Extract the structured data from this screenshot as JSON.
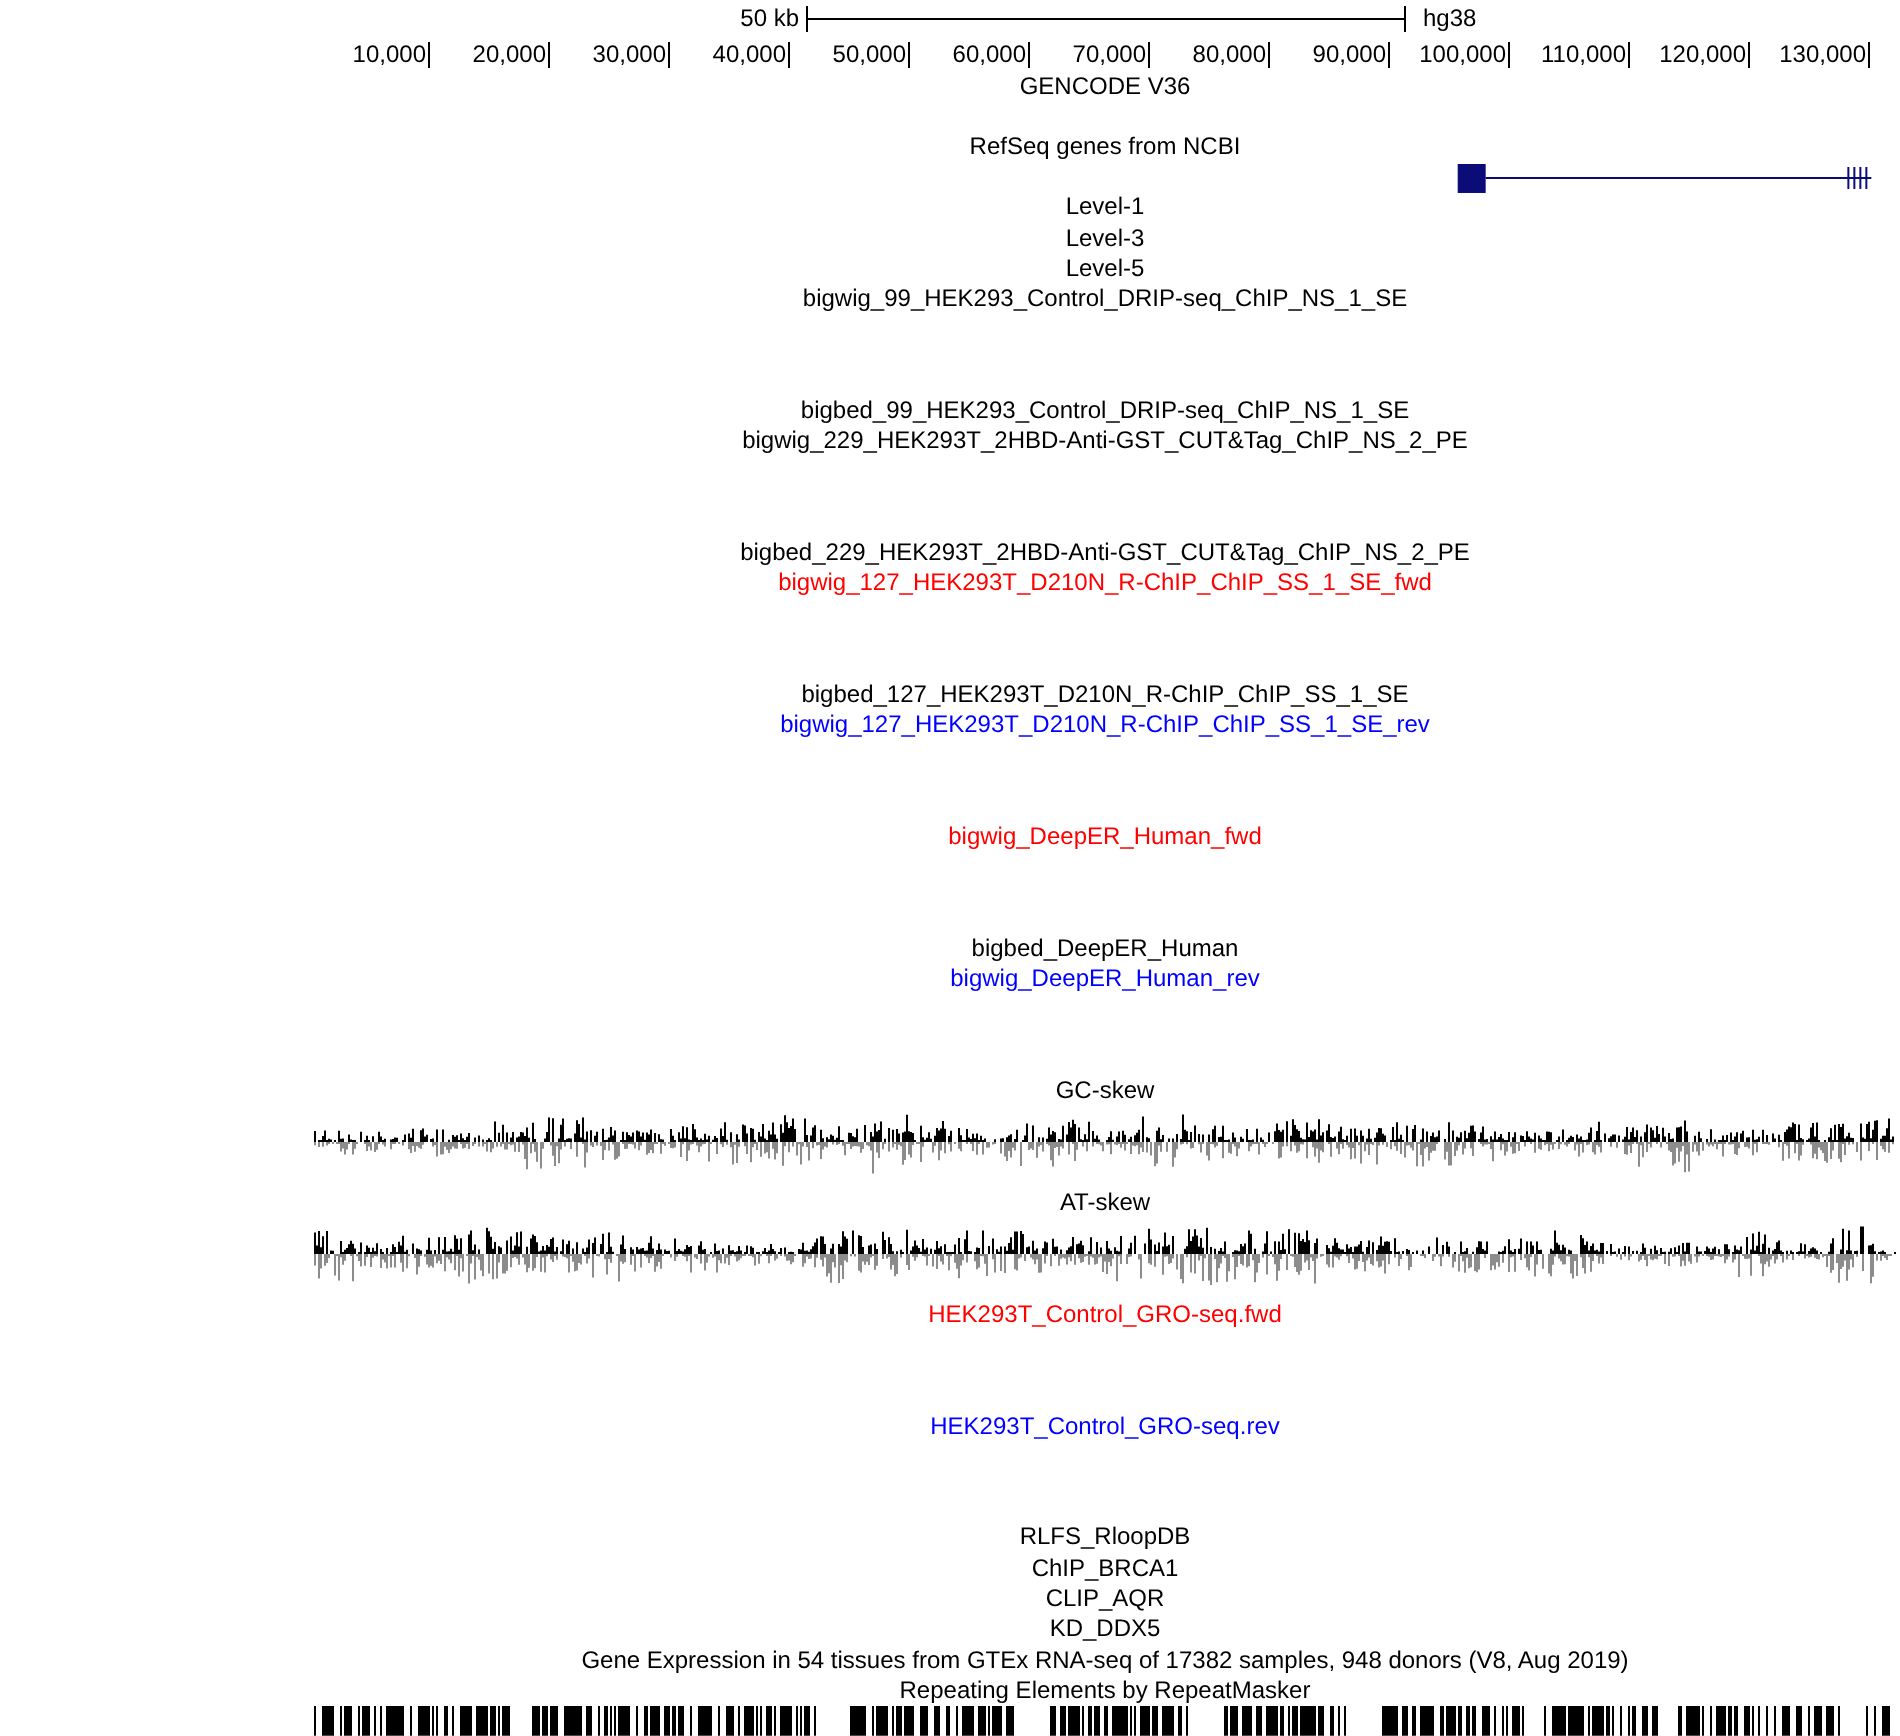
{
  "scale_bar": {
    "label": "50 kb",
    "assembly": "hg38"
  },
  "ruler": {
    "ticks": [
      "10,000",
      "20,000",
      "30,000",
      "40,000",
      "50,000",
      "60,000",
      "70,000",
      "80,000",
      "90,000",
      "100,000",
      "110,000",
      "120,000",
      "130,000"
    ]
  },
  "tracks": [
    {
      "label": "GENCODE V36",
      "kind": "annotation",
      "color": "#000000"
    },
    {
      "label": "RefSeq genes from NCBI",
      "kind": "gene",
      "color": "#000000"
    },
    {
      "label": "Level-1",
      "kind": "bed",
      "color": "#000000"
    },
    {
      "label": "Level-3",
      "kind": "bed",
      "color": "#000000"
    },
    {
      "label": "Level-5",
      "kind": "bed",
      "color": "#000000"
    },
    {
      "label": "bigwig_99_HEK293_Control_DRIP-seq_ChIP_NS_1_SE",
      "kind": "wiggle",
      "color": "#000000"
    },
    {
      "label": "bigbed_99_HEK293_Control_DRIP-seq_ChIP_NS_1_SE",
      "kind": "bed",
      "color": "#000000"
    },
    {
      "label": "bigwig_229_HEK293T_2HBD-Anti-GST_CUT&Tag_ChIP_NS_2_PE",
      "kind": "wiggle",
      "color": "#000000"
    },
    {
      "label": "bigbed_229_HEK293T_2HBD-Anti-GST_CUT&Tag_ChIP_NS_2_PE",
      "kind": "bed",
      "color": "#000000"
    },
    {
      "label": "bigwig_127_HEK293T_D210N_R-ChIP_ChIP_SS_1_SE_fwd",
      "kind": "wiggle",
      "color": "#ff0000"
    },
    {
      "label": "bigbed_127_HEK293T_D210N_R-ChIP_ChIP_SS_1_SE",
      "kind": "bed",
      "color": "#000000"
    },
    {
      "label": "bigwig_127_HEK293T_D210N_R-ChIP_ChIP_SS_1_SE_rev",
      "kind": "wiggle",
      "color": "#0000ff"
    },
    {
      "label": "bigwig_DeepER_Human_fwd",
      "kind": "wiggle",
      "color": "#ff0000"
    },
    {
      "label": "bigbed_DeepER_Human",
      "kind": "bed",
      "color": "#000000"
    },
    {
      "label": "bigwig_DeepER_Human_rev",
      "kind": "wiggle",
      "color": "#0000ff"
    },
    {
      "label": "GC-skew",
      "kind": "skew",
      "color": "#000000"
    },
    {
      "label": "AT-skew",
      "kind": "skew",
      "color": "#000000"
    },
    {
      "label": "HEK293T_Control_GRO-seq.fwd",
      "kind": "wiggle",
      "color": "#ff0000"
    },
    {
      "label": "HEK293T_Control_GRO-seq.rev",
      "kind": "wiggle",
      "color": "#0000ff"
    },
    {
      "label": "RLFS_RloopDB",
      "kind": "bed",
      "color": "#000000"
    },
    {
      "label": "ChIP_BRCA1",
      "kind": "bed",
      "color": "#000000"
    },
    {
      "label": "CLIP_AQR",
      "kind": "bed",
      "color": "#000000"
    },
    {
      "label": "KD_DDX5",
      "kind": "bed",
      "color": "#000000"
    },
    {
      "label": "Gene Expression in 54 tissues from GTEx RNA-seq of 17382 samples, 948 donors (V8, Aug 2019)",
      "kind": "bed",
      "color": "#000000"
    },
    {
      "label": "Repeating Elements by RepeatMasker",
      "kind": "repeat",
      "color": "#000000"
    }
  ]
}
